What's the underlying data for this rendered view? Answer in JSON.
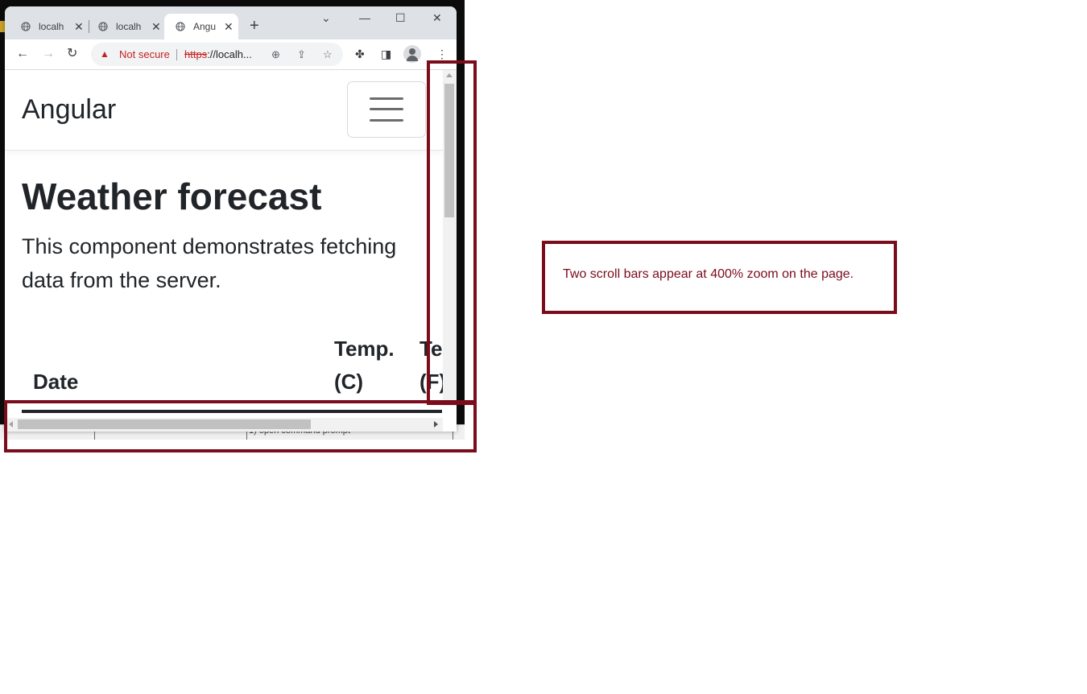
{
  "browser": {
    "tabs": [
      {
        "title": "localh",
        "active": false
      },
      {
        "title": "localh",
        "active": false
      },
      {
        "title": "Angu",
        "active": true
      }
    ],
    "new_tab_label": "+",
    "address_bar": {
      "security_label": "Not secure",
      "url_scheme": "https",
      "url_rest": "://localh..."
    }
  },
  "page": {
    "brand": "Angular",
    "title": "Weather forecast",
    "description": "This component demonstrates fetching data from the server.",
    "table_headers": [
      {
        "line1": "",
        "line2": "Date"
      },
      {
        "line1": "Temp.",
        "line2": "(C)"
      },
      {
        "line1": "Te",
        "line2": "(F)"
      }
    ]
  },
  "terminal": {
    "status_text": "1) open command prompt"
  },
  "annotation": {
    "text": "Two scroll bars appear at 400% zoom on the page.",
    "color": "#7b0c1c"
  }
}
